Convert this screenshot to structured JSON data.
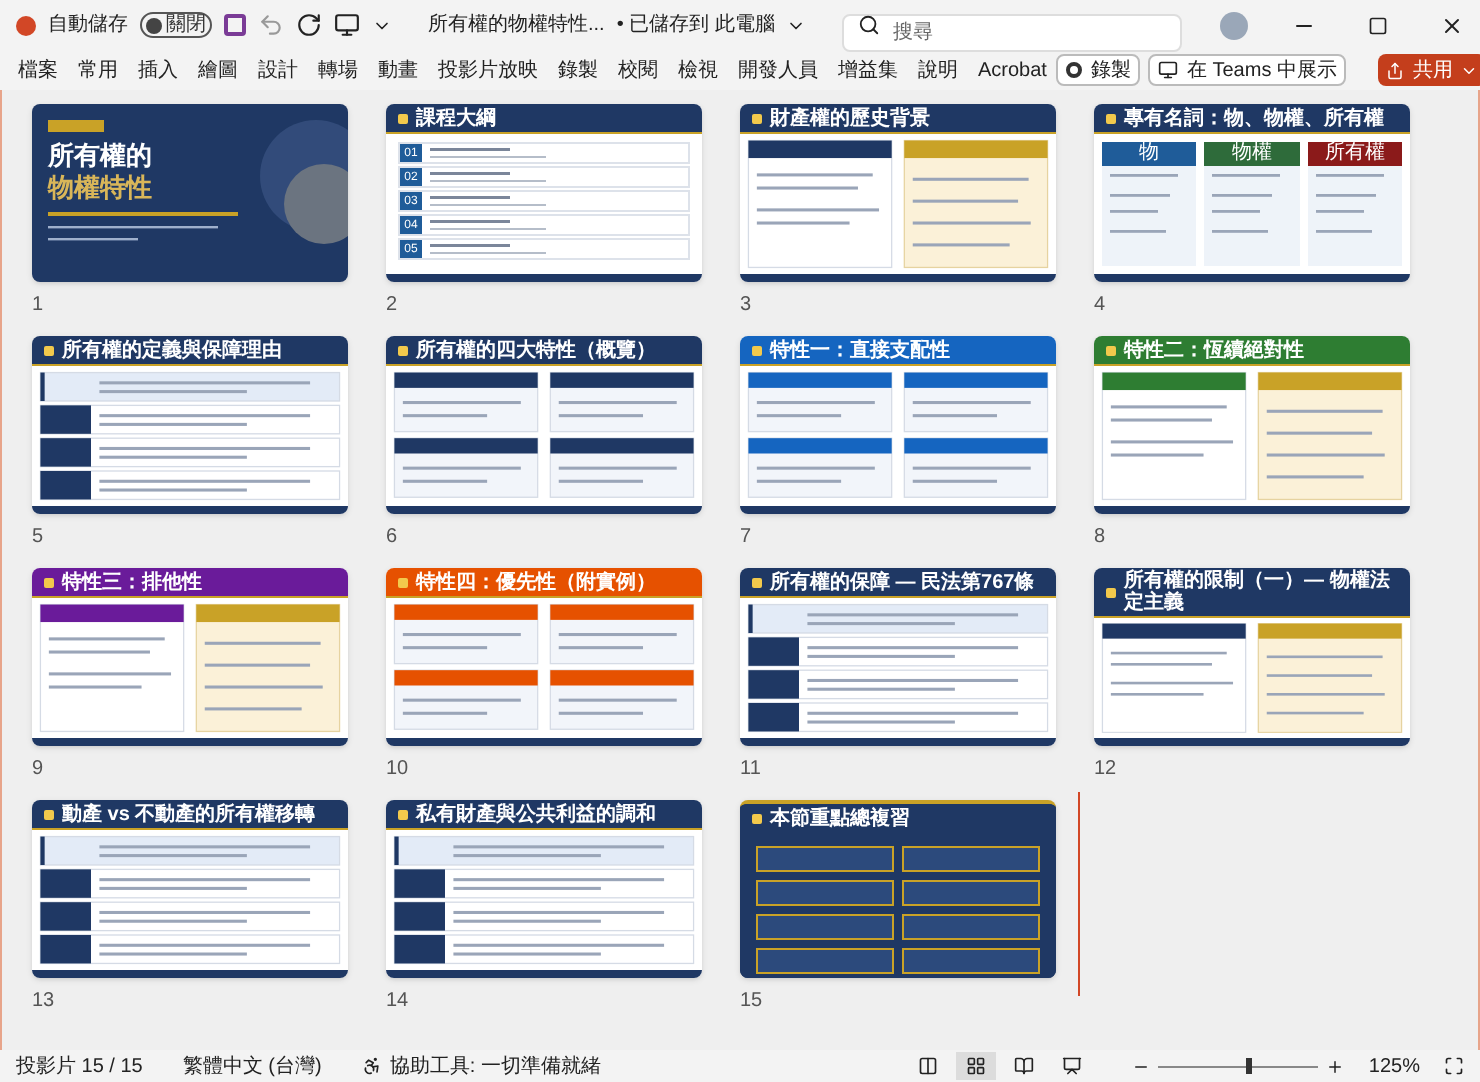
{
  "title_bar": {
    "autosave": {
      "label": "自動儲存",
      "on": false,
      "state_text": "關閉"
    },
    "document": "所有權的物權特性...",
    "save_status": "• 已儲存到 此電腦",
    "search": {
      "placeholder": "搜尋"
    }
  },
  "ribbon": {
    "tabs": [
      "檔案",
      "常用",
      "插入",
      "繪圖",
      "設計",
      "轉場",
      "動畫",
      "投影片放映",
      "錄製",
      "校閱",
      "檢視",
      "開發人員",
      "增益集",
      "說明",
      "Acrobat"
    ],
    "record_button": "錄製",
    "teams_button": "在 Teams 中展示",
    "share_button": "共用"
  },
  "slides": [
    {
      "number": "1",
      "kind": "title",
      "title_lines": [
        "所有權的",
        "物權特性"
      ],
      "cursor_after": false
    },
    {
      "number": "2",
      "kind": "numbered",
      "title": "課程大綱",
      "color": "#1f3864",
      "items": [
        "01",
        "02",
        "03",
        "04",
        "05"
      ],
      "cursor_after": false
    },
    {
      "number": "3",
      "kind": "two",
      "title": "財產權的歷史背景",
      "color": "#1f3864",
      "cursor_after": false
    },
    {
      "number": "4",
      "kind": "columns",
      "title": "專有名詞：物、物權、所有權",
      "color": "#1f3864",
      "columns": [
        {
          "label": "物",
          "color": "#1f5c99"
        },
        {
          "label": "物權",
          "color": "#2e6b3a"
        },
        {
          "label": "所有權",
          "color": "#8b1a1a"
        }
      ],
      "cursor_after": false
    },
    {
      "number": "5",
      "kind": "rows",
      "title": "所有權的定義與保障理由",
      "color": "#1f3864",
      "cursor_after": false
    },
    {
      "number": "6",
      "kind": "four",
      "title": "所有權的四大特性（概覽）",
      "color": "#1f3864",
      "cursor_after": false
    },
    {
      "number": "7",
      "kind": "four",
      "title": "特性一：直接支配性",
      "color": "#1565c0",
      "cursor_after": false
    },
    {
      "number": "8",
      "kind": "two",
      "title": "特性二：恆續絕對性",
      "color": "#2e7d32",
      "cursor_after": false
    },
    {
      "number": "9",
      "kind": "two",
      "title": "特性三：排他性",
      "color": "#6a1b9a",
      "cursor_after": false
    },
    {
      "number": "10",
      "kind": "four",
      "title": "特性四：優先性（附實例）",
      "color": "#e65100",
      "cursor_after": false
    },
    {
      "number": "11",
      "kind": "rows",
      "title": "所有權的保障 — 民法第767條",
      "color": "#1f3864",
      "cursor_after": false
    },
    {
      "number": "12",
      "kind": "two",
      "title": "所有權的限制（一）— 物權法定主義",
      "color": "#1f3864",
      "cursor_after": false
    },
    {
      "number": "13",
      "kind": "rows",
      "title": "動產 vs 不動產的所有權移轉",
      "color": "#1f3864",
      "cursor_after": false
    },
    {
      "number": "14",
      "kind": "rows",
      "title": "私有財產與公共利益的調和",
      "color": "#1f3864",
      "cursor_after": false
    },
    {
      "number": "15",
      "kind": "summary",
      "title": "本節重點總複習",
      "color": "#1f3864",
      "cursor_after": true
    }
  ],
  "status_bar": {
    "slide_count": "投影片 15 / 15",
    "language": "繁體中文 (台灣)",
    "accessibility": "協助工具: 一切準備就緒",
    "views": [
      {
        "kind": "normal",
        "selected": false
      },
      {
        "kind": "sorter",
        "selected": true
      },
      {
        "kind": "reading",
        "selected": false
      },
      {
        "kind": "presenter",
        "selected": false
      }
    ],
    "zoom": {
      "level": 0.56,
      "reading": "125%"
    }
  }
}
